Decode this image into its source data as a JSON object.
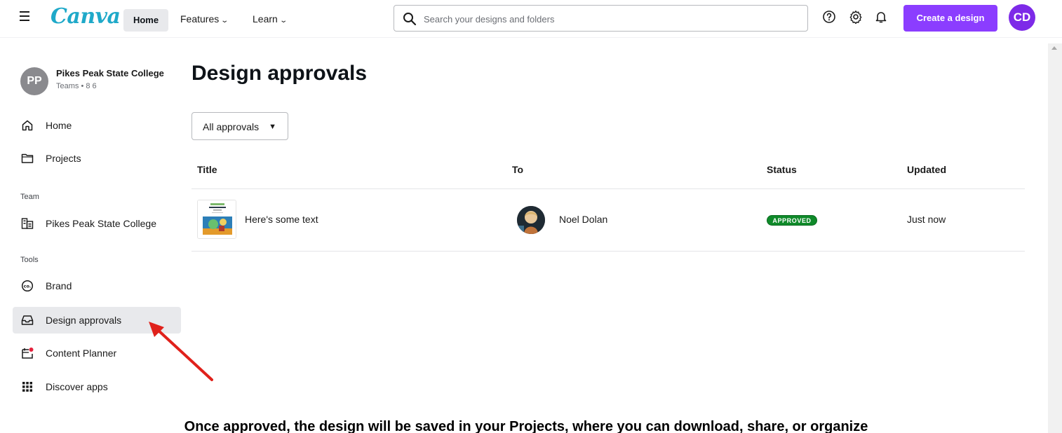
{
  "header": {
    "logo": "Canva",
    "nav": {
      "home": "Home",
      "features": "Features",
      "learn": "Learn"
    },
    "search": {
      "placeholder": "Search your designs and folders"
    },
    "create_button": "Create a design",
    "user_initials": "CD",
    "accent_color": "#8b3dff"
  },
  "sidebar": {
    "team": {
      "initials": "PP",
      "name": "Pikes Peak State College",
      "meta": "Teams • 8 6"
    },
    "items": [
      {
        "label": "Home",
        "icon": "home-icon"
      },
      {
        "label": "Projects",
        "icon": "folder-icon"
      }
    ],
    "team_section": {
      "heading": "Team",
      "items": [
        {
          "label": "Pikes Peak State College",
          "icon": "team-building-icon"
        }
      ]
    },
    "tools_section": {
      "heading": "Tools",
      "items": [
        {
          "label": "Brand",
          "icon": "brand-icon"
        },
        {
          "label": "Design approvals",
          "icon": "inbox-tray-icon",
          "active": true
        },
        {
          "label": "Content Planner",
          "icon": "calendar-icon"
        },
        {
          "label": "Discover apps",
          "icon": "apps-grid-icon"
        }
      ]
    }
  },
  "main": {
    "title": "Design approvals",
    "filter": {
      "selected": "All approvals"
    },
    "table": {
      "columns": [
        "Title",
        "To",
        "Status",
        "Updated"
      ],
      "rows": [
        {
          "title": "Here's some text",
          "to": "Noel Dolan",
          "status": "APPROVED",
          "updated": "Just now"
        }
      ]
    },
    "status_color": "#0f8a2a"
  },
  "caption": "Once approved, the design will be saved in your Projects, where you can download, share, or organize"
}
